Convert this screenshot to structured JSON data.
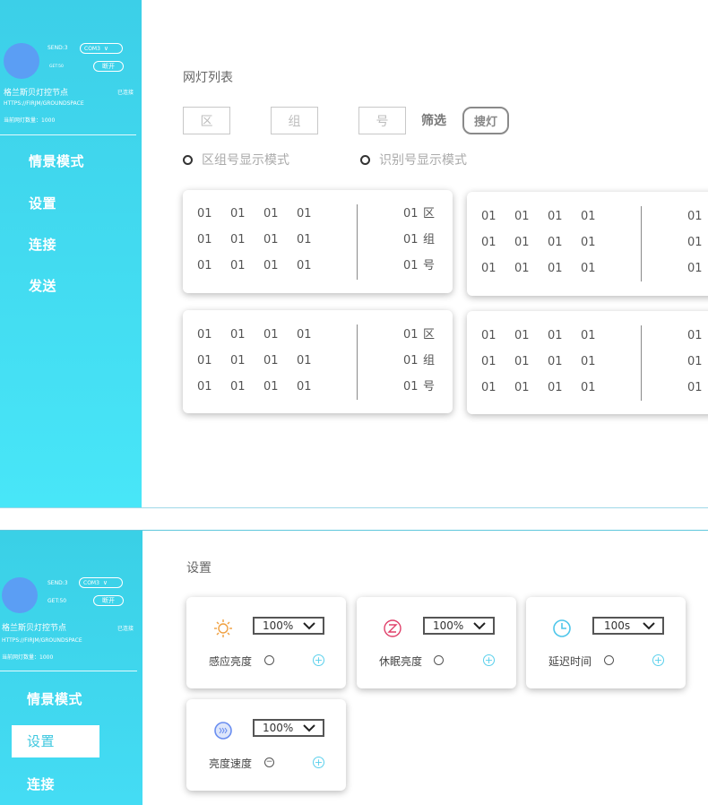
{
  "screen1": {
    "sidebar": {
      "send_label": "SEND:3",
      "com_select": "COM3",
      "get_label": "GET:50",
      "disconnect_label": "断开",
      "node_name": "格兰斯贝灯控节点",
      "status": "已连接",
      "url": "HTTPS://FIRJM/GROUNDSPACE",
      "lamp_count": "当前网灯数量：1000",
      "nav": [
        "情景模式",
        "设置",
        "连接",
        "发送"
      ]
    },
    "main": {
      "title": "网灯列表",
      "filter_zone_placeholder": "区",
      "filter_group_placeholder": "组",
      "filter_id_placeholder": "号",
      "filter_label": "筛选",
      "search_button": "搜灯",
      "mode_zone_group": "区组号显示模式",
      "mode_id": "识别号显示模式",
      "cards": [
        {
          "grid": [
            "01",
            "01",
            "01",
            "01",
            "01",
            "01",
            "01",
            "01",
            "01",
            "01",
            "01",
            "01"
          ],
          "right": [
            [
              "01",
              "区"
            ],
            [
              "01",
              "组"
            ],
            [
              "01",
              "号"
            ]
          ]
        },
        {
          "grid": [
            "01",
            "01",
            "01",
            "01",
            "01",
            "01",
            "01",
            "01",
            "01",
            "01",
            "01",
            "01"
          ],
          "right": [
            [
              "01",
              ""
            ],
            [
              "01",
              ""
            ],
            [
              "01",
              ""
            ]
          ]
        },
        {
          "grid": [
            "01",
            "01",
            "01",
            "01",
            "01",
            "01",
            "01",
            "01",
            "01",
            "01",
            "01",
            "01"
          ],
          "right": [
            [
              "01",
              "区"
            ],
            [
              "01",
              "组"
            ],
            [
              "01",
              "号"
            ]
          ]
        },
        {
          "grid": [
            "01",
            "01",
            "01",
            "01",
            "01",
            "01",
            "01",
            "01",
            "01",
            "01",
            "01",
            "01"
          ],
          "right": [
            [
              "01",
              ""
            ],
            [
              "01",
              ""
            ],
            [
              "01",
              ""
            ]
          ]
        }
      ]
    }
  },
  "screen2": {
    "sidebar": {
      "send_label": "SEND:3",
      "com_select": "COM3",
      "get_label": "GET:50",
      "disconnect_label": "断开",
      "node_name": "格兰斯贝灯控节点",
      "status": "已连接",
      "url": "HTTPS://FIRJM/GROUNDSPACE",
      "lamp_count": "当前网灯数量：1000",
      "nav": [
        "情景模式",
        "设置",
        "连接"
      ]
    },
    "main": {
      "title": "设置",
      "settings": [
        {
          "icon": "sun-icon",
          "value": "100%",
          "label": "感应亮度"
        },
        {
          "icon": "sleep-icon",
          "value": "100%",
          "label": "休眠亮度"
        },
        {
          "icon": "clock-icon",
          "value": "100s",
          "label": "延迟时间"
        },
        {
          "icon": "speed-icon",
          "value": "100%",
          "label": "亮度速度"
        }
      ]
    }
  },
  "colors": {
    "sidebar": "#3ccfe8",
    "avatar": "#5b9ef4",
    "accent": "#5ad0ec",
    "sun": "#f0a040",
    "sleep": "#e0406a",
    "clock": "#4fc6ea",
    "speed": "#6a8ef0"
  }
}
